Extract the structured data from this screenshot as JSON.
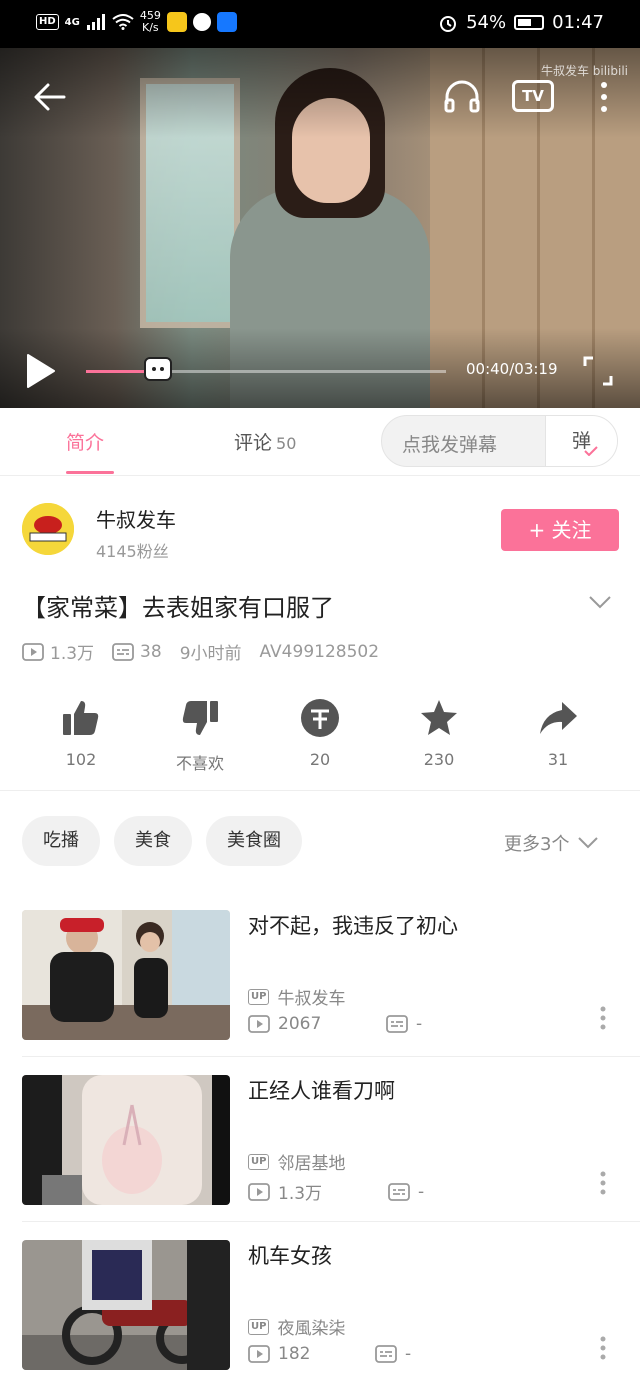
{
  "status_bar": {
    "hd": "HD",
    "network": "4G",
    "speed_value": "459",
    "speed_unit": "K/s",
    "battery": "54%",
    "time": "01:47"
  },
  "player": {
    "watermark": "牛叔发车 bilibili",
    "tv_label": "TV",
    "current_time": "00:40",
    "duration": "03:19",
    "time_display": "00:40/03:19",
    "progress_fraction": 0.2
  },
  "tabs": {
    "intro": "简介",
    "comments": "评论",
    "comments_count": "50",
    "danmaku_placeholder": "点我发弹幕",
    "danmaku_button": "弹"
  },
  "uploader": {
    "name": "牛叔发车",
    "fans": "4145粉丝",
    "follow_label": "+ 关注"
  },
  "video": {
    "title": "【家常菜】去表姐家有口服了",
    "views": "1.3万",
    "danmaku_count": "38",
    "posted": "9小时前",
    "av_id": "AV499128502"
  },
  "actions": {
    "like": "102",
    "dislike": "不喜欢",
    "coin": "20",
    "favorite": "230",
    "share": "31"
  },
  "tags": {
    "items": [
      "吃播",
      "美食",
      "美食圈"
    ],
    "more": "更多3个"
  },
  "related": [
    {
      "title": "对不起，我违反了初心",
      "up": "牛叔发车",
      "views": "2067",
      "danmaku": "-"
    },
    {
      "title": "正经人谁看刀啊",
      "up": "邻居基地",
      "views": "1.3万",
      "danmaku": "-"
    },
    {
      "title": "机车女孩",
      "up": "夜風染柒",
      "views": "182",
      "danmaku": "-"
    }
  ],
  "up_badge": "UP",
  "colors": {
    "accent": "#fb7299",
    "status_bar": "#000000"
  }
}
